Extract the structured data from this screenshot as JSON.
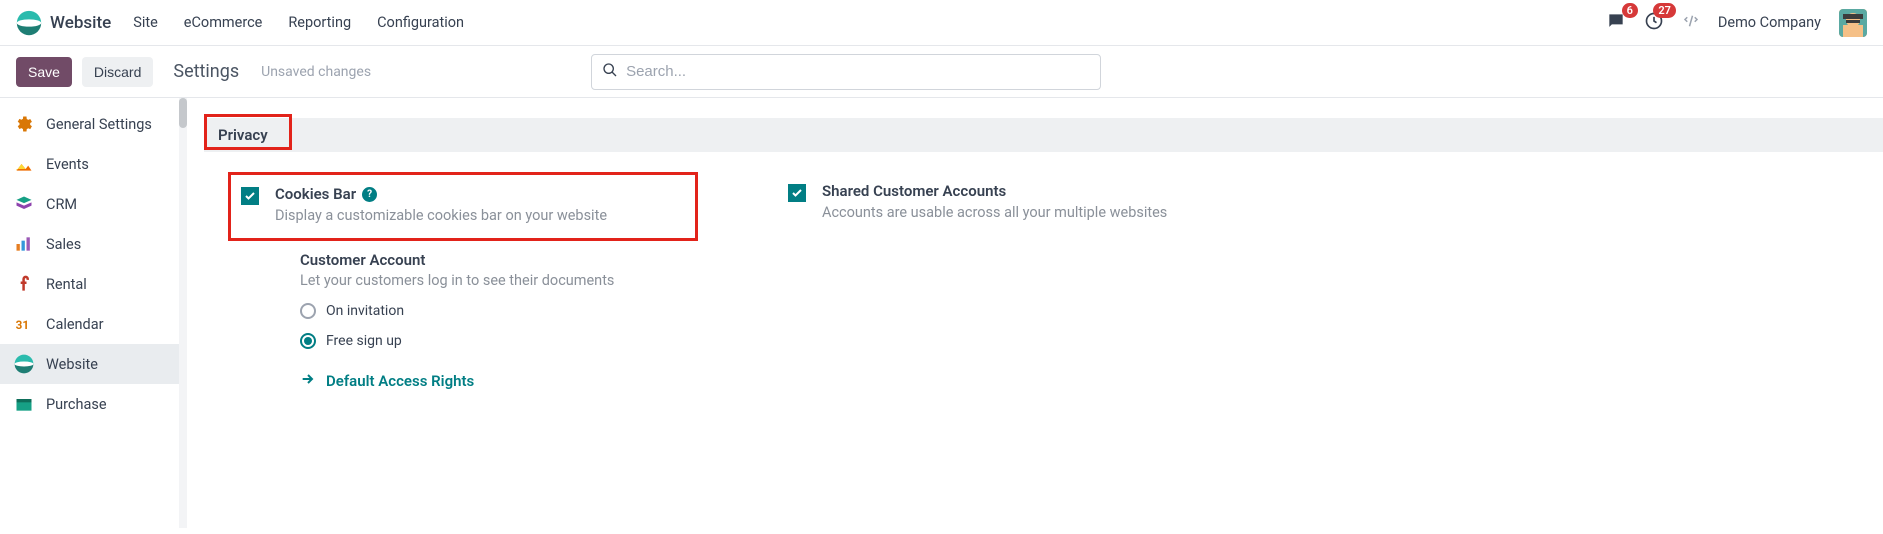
{
  "header": {
    "brand": "Website",
    "menu": [
      "Site",
      "eCommerce",
      "Reporting",
      "Configuration"
    ],
    "msg_badge": "6",
    "activity_badge": "27",
    "company": "Demo Company"
  },
  "actionbar": {
    "save": "Save",
    "discard": "Discard",
    "title": "Settings",
    "status": "Unsaved changes",
    "search_placeholder": "Search..."
  },
  "sidebar": {
    "items": [
      {
        "label": "General Settings"
      },
      {
        "label": "Events"
      },
      {
        "label": "CRM"
      },
      {
        "label": "Sales"
      },
      {
        "label": "Rental"
      },
      {
        "label": "Calendar"
      },
      {
        "label": "Website"
      },
      {
        "label": "Purchase"
      }
    ]
  },
  "section": {
    "title": "Privacy",
    "cookies": {
      "title": "Cookies Bar",
      "desc": "Display a customizable cookies bar on your website"
    },
    "shared": {
      "title": "Shared Customer Accounts",
      "desc": "Accounts are usable across all your multiple websites"
    },
    "custacct": {
      "title": "Customer Account",
      "desc": "Let your customers log in to see their documents",
      "opt1": "On invitation",
      "opt2": "Free sign up",
      "link": "Default Access Rights"
    }
  }
}
